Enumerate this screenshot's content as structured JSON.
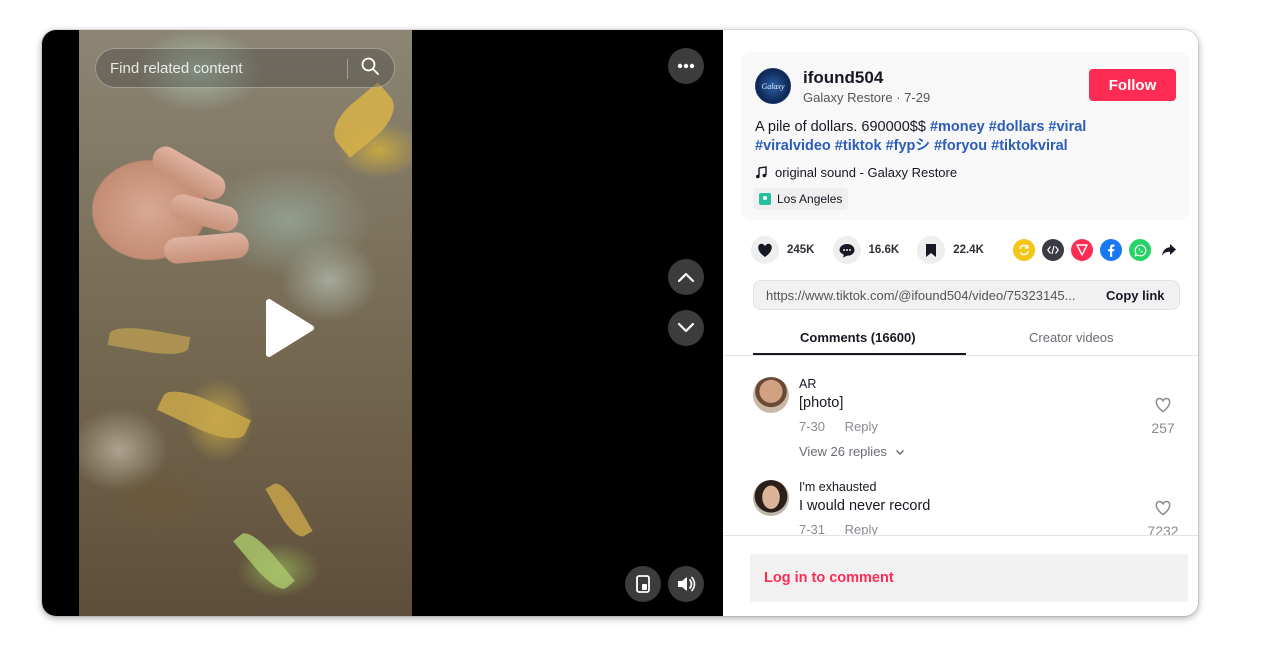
{
  "video": {
    "search_placeholder": "Find related content"
  },
  "post": {
    "username": "ifound504",
    "display_name": "Galaxy Restore",
    "date": "7-29",
    "avatar_text": "Galaxy",
    "follow_label": "Follow",
    "description_text": "A pile of dollars. 690000$$",
    "hashtags": [
      "#money",
      "#dollars",
      "#viral",
      "#viralvideo",
      "#tiktok",
      "#fypシ",
      "#foryou",
      "#tiktokviral"
    ],
    "sound": "original sound - Galaxy Restore",
    "location": "Los Angeles"
  },
  "stats": {
    "likes": "245K",
    "comments": "16.6K",
    "saves": "22.4K"
  },
  "share_icons": [
    "repost-icon",
    "embed-icon",
    "send-icon",
    "facebook-icon",
    "whatsapp-icon",
    "share-arrow-icon"
  ],
  "link": {
    "url": "https://www.tiktok.com/@ifound504/video/75323145...",
    "copy_label": "Copy link"
  },
  "tabs": {
    "comments_label": "Comments (16600)",
    "creator_label": "Creator videos"
  },
  "comments": [
    {
      "name": "AR",
      "text": "[photo]",
      "date": "7-30",
      "reply_label": "Reply",
      "likes": "257",
      "view_replies": "View 26 replies"
    },
    {
      "name": "I'm exhausted",
      "text": "I would never record",
      "date": "7-31",
      "reply_label": "Reply",
      "likes": "7232"
    }
  ],
  "footer": {
    "login_label": "Log in to comment"
  },
  "colors": {
    "accent": "#fe2c55",
    "hashtag": "#2b5db9"
  }
}
